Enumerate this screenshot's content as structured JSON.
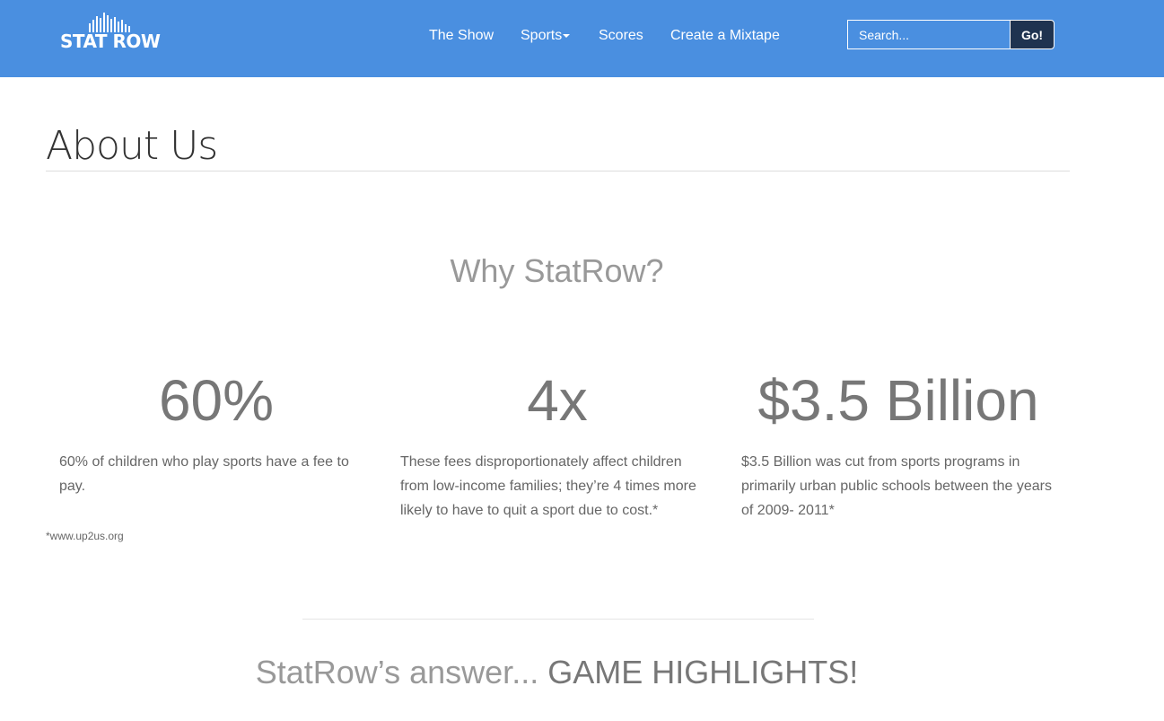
{
  "colors": {
    "navbar_bg": "#4a8fe0",
    "go_button_bg": "#1f3350",
    "stat_text": "#777777",
    "heading_gray": "#999999"
  },
  "header": {
    "logo_text": "STAT ROW",
    "nav": [
      {
        "label": "The Show"
      },
      {
        "label": "Sports",
        "has_dropdown": true
      },
      {
        "label": "Scores"
      },
      {
        "label": "Create a Mixtape"
      }
    ],
    "search": {
      "placeholder": "Search...",
      "value": "",
      "button_label": "Go!"
    }
  },
  "main": {
    "title": "About Us",
    "why_heading": "Why StatRow?",
    "stats": [
      {
        "value": "60%",
        "description": "60% of children who play sports have a fee to pay."
      },
      {
        "value": "4x",
        "description": "These fees disproportionately affect children from low-income families; they’re 4 times more likely to have to quit a sport due to cost.*"
      },
      {
        "value": "$3.5 Billion",
        "description": "$3.5 Billion was cut from sports programs in primarily urban public schools between the years of 2009- 2011*"
      }
    ],
    "source_note": "*www.up2us.org",
    "answer": {
      "lead": "StatRow’s answer...",
      "emphasis": "GAME HIGHLIGHTS!"
    }
  }
}
